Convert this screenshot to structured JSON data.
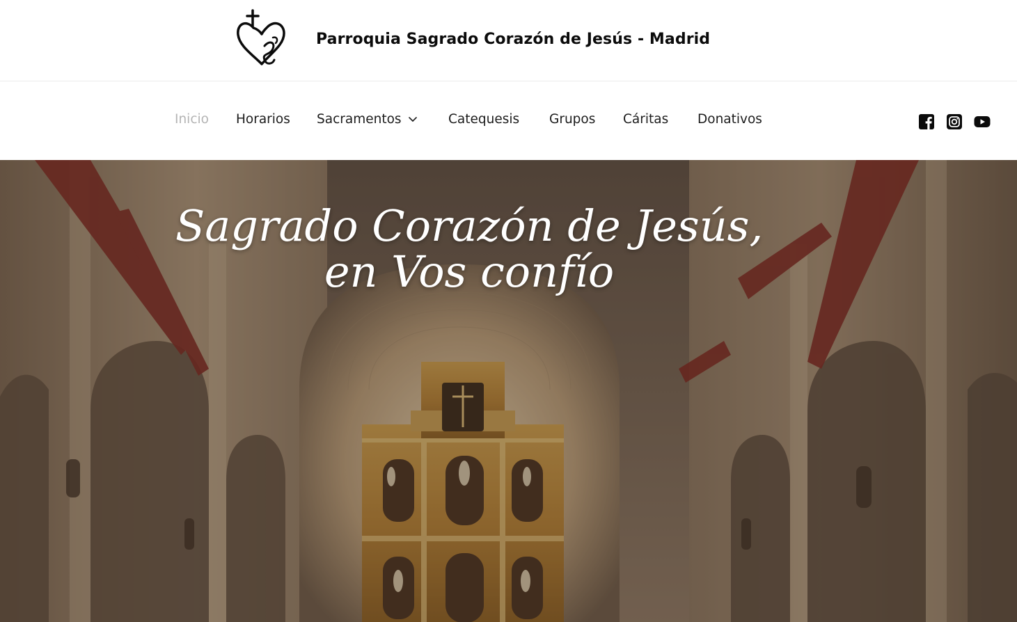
{
  "header": {
    "site_title": "Parroquia Sagrado Corazón de Jesús - Madrid",
    "logo_icon": "heart-cross-logo-icon"
  },
  "nav": {
    "items": [
      {
        "label": "Inicio",
        "active": true
      },
      {
        "label": "Horarios",
        "active": false
      },
      {
        "label": "Sacramentos",
        "active": false,
        "has_dropdown": true
      },
      {
        "label": "Catequesis",
        "active": false
      },
      {
        "label": "Grupos",
        "active": false
      },
      {
        "label": "Cáritas",
        "active": false
      },
      {
        "label": "Donativos",
        "active": false
      }
    ],
    "active_color": "#b4b4b4",
    "text_color": "#1c1c1c"
  },
  "social": {
    "icons": [
      "facebook-icon",
      "instagram-icon",
      "youtube-icon"
    ]
  },
  "hero": {
    "title_line1": "Sagrado Corazón de Jesús,",
    "title_line2": "en Vos confío",
    "image_icon": "church-interior-altarpiece-image"
  }
}
